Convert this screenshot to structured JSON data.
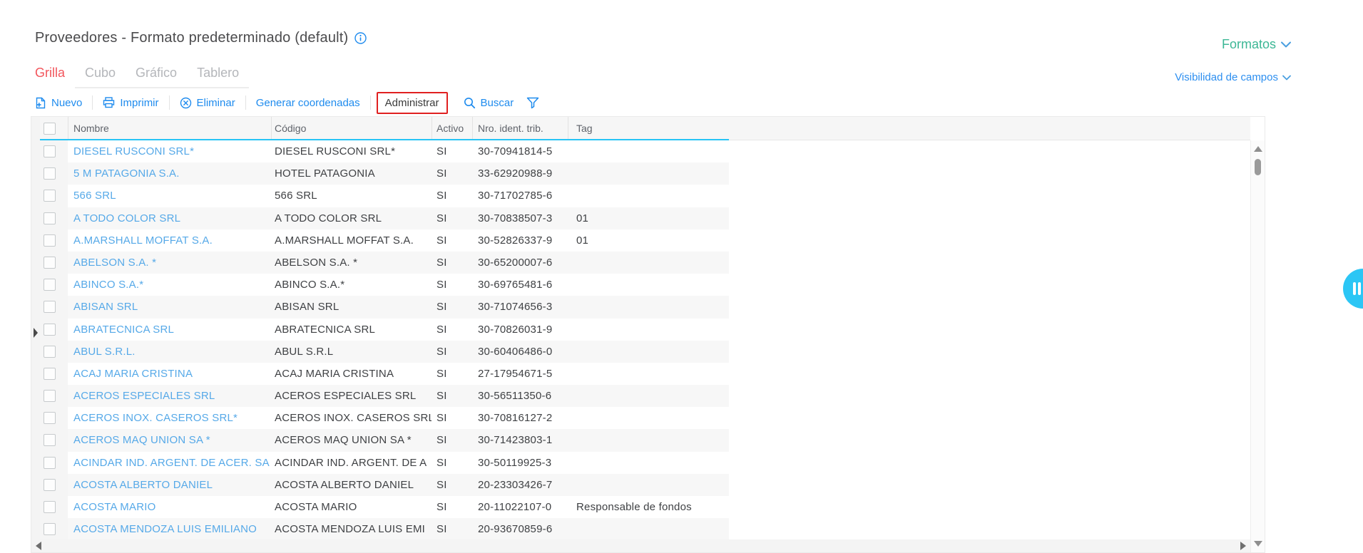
{
  "header": {
    "title": "Proveedores - Formato predeterminado (default)",
    "formats": {
      "label": "Formatos"
    },
    "field_visibility": {
      "label": "Visibilidad de campos"
    }
  },
  "tabs": {
    "items": [
      {
        "label": "Grilla",
        "active": true
      },
      {
        "label": "Cubo",
        "active": false
      },
      {
        "label": "Gráfico",
        "active": false
      },
      {
        "label": "Tablero",
        "active": false
      }
    ]
  },
  "toolbar": {
    "nuevo": {
      "label": "Nuevo",
      "icon": "new-document-icon"
    },
    "imprimir": {
      "label": "Imprimir",
      "icon": "printer-icon"
    },
    "eliminar": {
      "label": "Eliminar",
      "icon": "delete-icon"
    },
    "generar": {
      "label": "Generar coordenadas"
    },
    "administrar": {
      "label": "Administrar",
      "annotated": true
    },
    "buscar": {
      "label": "Buscar",
      "icon": "search-icon"
    },
    "filter_icon": "filter-icon"
  },
  "table": {
    "columns": [
      "Nombre",
      "Código",
      "Activo",
      "Nro. ident. trib.",
      "Tag"
    ],
    "rows": [
      {
        "nombre": "DIESEL RUSCONI SRL*",
        "codigo": "DIESEL RUSCONI SRL*",
        "activo": "SI",
        "nit": "30-70941814-5",
        "tag": ""
      },
      {
        "nombre": "5 M PATAGONIA S.A.",
        "codigo": "HOTEL PATAGONIA",
        "activo": "SI",
        "nit": "33-62920988-9",
        "tag": ""
      },
      {
        "nombre": "566 SRL",
        "codigo": "566 SRL",
        "activo": "SI",
        "nit": "30-71702785-6",
        "tag": ""
      },
      {
        "nombre": "A TODO COLOR SRL",
        "codigo": "A TODO COLOR SRL",
        "activo": "SI",
        "nit": "30-70838507-3",
        "tag": "01"
      },
      {
        "nombre": "A.MARSHALL MOFFAT S.A.",
        "codigo": "A.MARSHALL MOFFAT S.A.",
        "activo": "SI",
        "nit": "30-52826337-9",
        "tag": "01"
      },
      {
        "nombre": "ABELSON S.A. *",
        "codigo": "ABELSON S.A. *",
        "activo": "SI",
        "nit": "30-65200007-6",
        "tag": ""
      },
      {
        "nombre": "ABINCO S.A.*",
        "codigo": "ABINCO S.A.*",
        "activo": "SI",
        "nit": "30-69765481-6",
        "tag": ""
      },
      {
        "nombre": "ABISAN SRL",
        "codigo": "ABISAN SRL",
        "activo": "SI",
        "nit": "30-71074656-3",
        "tag": ""
      },
      {
        "nombre": "ABRATECNICA SRL",
        "codigo": "ABRATECNICA SRL",
        "activo": "SI",
        "nit": "30-70826031-9",
        "tag": ""
      },
      {
        "nombre": "ABUL S.R.L.",
        "codigo": "ABUL S.R.L",
        "activo": "SI",
        "nit": "30-60406486-0",
        "tag": ""
      },
      {
        "nombre": "ACAJ MARIA CRISTINA",
        "codigo": "ACAJ MARIA CRISTINA",
        "activo": "SI",
        "nit": "27-17954671-5",
        "tag": ""
      },
      {
        "nombre": "ACEROS ESPECIALES SRL",
        "codigo": "ACEROS ESPECIALES SRL",
        "activo": "SI",
        "nit": "30-56511350-6",
        "tag": ""
      },
      {
        "nombre": "ACEROS INOX. CASEROS SRL*",
        "codigo": "ACEROS INOX. CASEROS SRL",
        "activo": "SI",
        "nit": "30-70816127-2",
        "tag": ""
      },
      {
        "nombre": "ACEROS MAQ UNION SA *",
        "codigo": "ACEROS MAQ UNION SA *",
        "activo": "SI",
        "nit": "30-71423803-1",
        "tag": ""
      },
      {
        "nombre": "ACINDAR IND. ARGENT. DE ACER. SA",
        "codigo": "ACINDAR IND. ARGENT. DE A",
        "activo": "SI",
        "nit": "30-50119925-3",
        "tag": ""
      },
      {
        "nombre": "ACOSTA ALBERTO DANIEL",
        "codigo": "ACOSTA ALBERTO DANIEL",
        "activo": "SI",
        "nit": "20-23303426-7",
        "tag": ""
      },
      {
        "nombre": "ACOSTA MARIO",
        "codigo": "ACOSTA MARIO",
        "activo": "SI",
        "nit": "20-11022107-0",
        "tag": "Responsable de fondos"
      },
      {
        "nombre": "ACOSTA MENDOZA LUIS EMILIANO",
        "codigo": "ACOSTA MENDOZA LUIS EMI",
        "activo": "SI",
        "nit": "20-93670859-6",
        "tag": ""
      }
    ]
  },
  "colors": {
    "toolbar_blue": "#1e8bee",
    "link_blue": "#56a9e8",
    "active_tab_red": "#f2555c",
    "formats_green": "#3cb795",
    "annotation_red": "#e02020",
    "header_underline_cyan": "#27c4f5",
    "floating_button_cyan": "#2cc6f5"
  }
}
